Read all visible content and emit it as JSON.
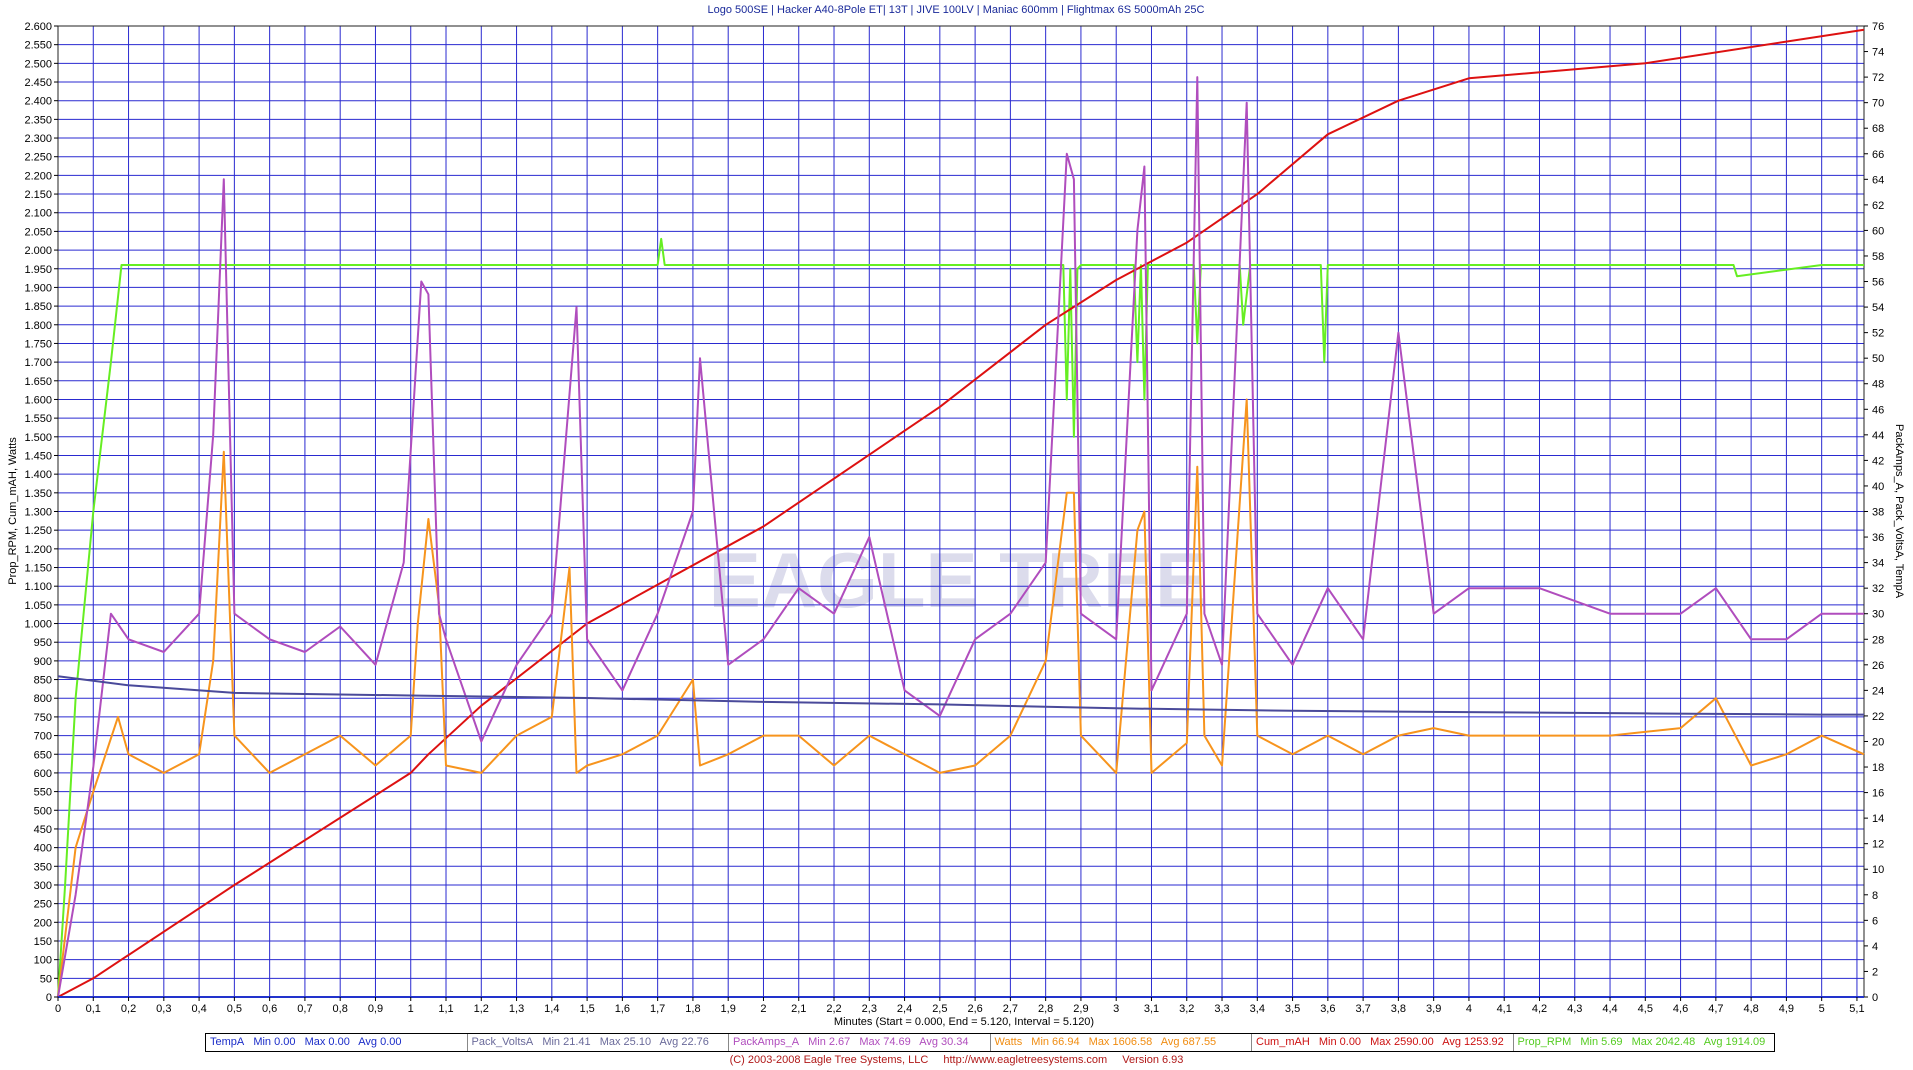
{
  "chart_data": {
    "type": "line",
    "title": "Logo 500SE | Hacker A40-8Pole ET| 13T | JIVE 100LV | Maniac 600mm | Flightmax 6S 5000mAh 25C",
    "xlabel": "Minutes (Start = 0.000, End = 5.120, Interval = 5.120)",
    "ylabel_left": "Prop_RPM, Cum_mAH, Watts",
    "ylabel_right": "PackAmps_A, Pack_VoltsA, TempA",
    "xlim": [
      0,
      5.12
    ],
    "ylim_left": [
      0,
      2600
    ],
    "ylim_right": [
      0,
      76
    ],
    "x_ticks": [
      "0",
      "0,1",
      "0,2",
      "0,3",
      "0,4",
      "0,5",
      "0,6",
      "0,7",
      "0,8",
      "0,9",
      "1",
      "1,1",
      "1,2",
      "1,3",
      "1,4",
      "1,5",
      "1,6",
      "1,7",
      "1,8",
      "1,9",
      "2",
      "2,1",
      "2,2",
      "2,3",
      "2,4",
      "2,5",
      "2,6",
      "2,7",
      "2,8",
      "2,9",
      "3",
      "3,1",
      "3,2",
      "3,3",
      "3,4",
      "3,5",
      "3,6",
      "3,7",
      "3,8",
      "3,9",
      "4",
      "4,1",
      "4,2",
      "4,3",
      "4,4",
      "4,5",
      "4,6",
      "4,7",
      "4,8",
      "4,9",
      "5",
      "5,1"
    ],
    "y_ticks_left": [
      "0",
      "50",
      "100",
      "150",
      "200",
      "250",
      "300",
      "350",
      "400",
      "450",
      "500",
      "550",
      "600",
      "650",
      "700",
      "750",
      "800",
      "850",
      "900",
      "950",
      "1.000",
      "1.050",
      "1.100",
      "1.150",
      "1.200",
      "1.250",
      "1.300",
      "1.350",
      "1.400",
      "1.450",
      "1.500",
      "1.550",
      "1.600",
      "1.650",
      "1.700",
      "1.750",
      "1.800",
      "1.850",
      "1.900",
      "1.950",
      "2.000",
      "2.050",
      "2.100",
      "2.150",
      "2.200",
      "2.250",
      "2.300",
      "2.350",
      "2.400",
      "2.450",
      "2.500",
      "2.550",
      "2.600"
    ],
    "y_ticks_right": [
      "0",
      "2",
      "4",
      "6",
      "8",
      "10",
      "12",
      "14",
      "16",
      "18",
      "20",
      "22",
      "24",
      "26",
      "28",
      "30",
      "32",
      "34",
      "36",
      "38",
      "40",
      "42",
      "44",
      "46",
      "48",
      "50",
      "52",
      "54",
      "56",
      "58",
      "60",
      "62",
      "64",
      "66",
      "68",
      "70",
      "72",
      "74",
      "76"
    ],
    "grid": true,
    "watermark": "EAGLE TREE",
    "series": [
      {
        "name": "Prop_RPM",
        "axis": "left",
        "color": "#66ee22",
        "x": [
          0,
          0.02,
          0.05,
          0.1,
          0.15,
          0.18,
          0.5,
          1.0,
          1.5,
          1.7,
          1.71,
          1.72,
          2.0,
          2.5,
          2.85,
          2.86,
          2.87,
          2.88,
          2.89,
          2.9,
          3.05,
          3.06,
          3.07,
          3.08,
          3.09,
          3.1,
          3.22,
          3.23,
          3.24,
          3.3,
          3.35,
          3.36,
          3.38,
          3.58,
          3.59,
          3.6,
          3.61,
          3.8,
          4.0,
          4.5,
          4.75,
          4.76,
          5.0,
          5.12
        ],
        "y": [
          0,
          300,
          800,
          1300,
          1700,
          1960,
          1960,
          1960,
          1960,
          1960,
          2030,
          1960,
          1960,
          1960,
          1960,
          1600,
          1950,
          1500,
          1950,
          1960,
          1960,
          1700,
          1960,
          1600,
          1960,
          1960,
          1960,
          1750,
          1960,
          1960,
          1960,
          1800,
          1960,
          1960,
          1700,
          1960,
          1960,
          1960,
          1960,
          1960,
          1960,
          1930,
          1960,
          1960
        ]
      },
      {
        "name": "Cum_mAH",
        "axis": "left",
        "color": "#dd1111",
        "x": [
          0,
          0.1,
          0.5,
          1.0,
          1.05,
          1.2,
          1.5,
          2.0,
          2.5,
          2.8,
          3.0,
          3.2,
          3.4,
          3.6,
          3.8,
          4.0,
          4.5,
          5.12
        ],
        "y": [
          0,
          50,
          300,
          600,
          650,
          780,
          1000,
          1260,
          1580,
          1800,
          1920,
          2020,
          2150,
          2310,
          2400,
          2460,
          2500,
          2590
        ]
      },
      {
        "name": "Watts",
        "axis": "left",
        "color": "#f7941d",
        "x": [
          0,
          0.05,
          0.1,
          0.17,
          0.2,
          0.3,
          0.4,
          0.44,
          0.47,
          0.5,
          0.6,
          0.7,
          0.8,
          0.9,
          1.0,
          1.02,
          1.05,
          1.08,
          1.1,
          1.2,
          1.3,
          1.4,
          1.45,
          1.47,
          1.5,
          1.6,
          1.7,
          1.8,
          1.82,
          1.9,
          2.0,
          2.1,
          2.2,
          2.3,
          2.4,
          2.5,
          2.6,
          2.7,
          2.8,
          2.86,
          2.88,
          2.9,
          3.0,
          3.06,
          3.08,
          3.1,
          3.2,
          3.23,
          3.25,
          3.3,
          3.37,
          3.4,
          3.5,
          3.6,
          3.7,
          3.8,
          3.9,
          4.0,
          4.2,
          4.4,
          4.6,
          4.7,
          4.8,
          4.9,
          5.0,
          5.12
        ],
        "y": [
          0,
          400,
          550,
          750,
          650,
          600,
          650,
          900,
          1460,
          700,
          600,
          650,
          700,
          620,
          700,
          1000,
          1280,
          1050,
          620,
          600,
          700,
          750,
          1150,
          600,
          620,
          650,
          700,
          850,
          620,
          650,
          700,
          700,
          620,
          700,
          650,
          600,
          620,
          700,
          900,
          1350,
          1350,
          700,
          600,
          1250,
          1300,
          600,
          680,
          1420,
          700,
          620,
          1600,
          700,
          650,
          700,
          650,
          700,
          720,
          700,
          700,
          700,
          720,
          800,
          620,
          650,
          700,
          650
        ]
      },
      {
        "name": "PackAmps_A",
        "axis": "right",
        "color": "#b04dbd",
        "x": [
          0,
          0.05,
          0.1,
          0.15,
          0.2,
          0.3,
          0.4,
          0.44,
          0.47,
          0.5,
          0.6,
          0.7,
          0.8,
          0.9,
          0.98,
          1.03,
          1.05,
          1.08,
          1.1,
          1.2,
          1.3,
          1.4,
          1.47,
          1.5,
          1.6,
          1.7,
          1.8,
          1.82,
          1.9,
          2.0,
          2.1,
          2.2,
          2.3,
          2.4,
          2.5,
          2.6,
          2.7,
          2.8,
          2.86,
          2.88,
          2.9,
          3.0,
          3.06,
          3.08,
          3.1,
          3.2,
          3.23,
          3.25,
          3.3,
          3.37,
          3.4,
          3.5,
          3.6,
          3.7,
          3.8,
          3.9,
          4.0,
          4.2,
          4.4,
          4.6,
          4.7,
          4.8,
          4.9,
          5.0,
          5.12
        ],
        "y": [
          0,
          8,
          18,
          30,
          28,
          27,
          30,
          44,
          64,
          30,
          28,
          27,
          29,
          26,
          34,
          56,
          55,
          30,
          28,
          20,
          26,
          30,
          54,
          28,
          24,
          30,
          38,
          50,
          26,
          28,
          32,
          30,
          36,
          24,
          22,
          28,
          30,
          34,
          66,
          64,
          30,
          28,
          60,
          65,
          24,
          30,
          72,
          30,
          26,
          70,
          30,
          26,
          32,
          28,
          52,
          30,
          32,
          32,
          30,
          30,
          32,
          28,
          28,
          30,
          30
        ]
      },
      {
        "name": "Pack_VoltsA",
        "axis": "right",
        "color": "#4a4a9a",
        "x": [
          0,
          0.2,
          0.5,
          1.0,
          1.5,
          2.0,
          2.5,
          3.0,
          3.5,
          4.0,
          4.5,
          5.0,
          5.12
        ],
        "y": [
          25.1,
          24.4,
          23.8,
          23.6,
          23.4,
          23.1,
          22.9,
          22.6,
          22.4,
          22.3,
          22.2,
          22.1,
          22.1
        ]
      },
      {
        "name": "TempA",
        "axis": "right",
        "color": "#2233cc",
        "x": [
          0,
          5.12
        ],
        "y": [
          0,
          0
        ]
      }
    ],
    "legend": [
      {
        "name": "TempA",
        "min": "Min 0.00",
        "max": "Max 0.00",
        "avg": "Avg 0.00",
        "color": "#1a2cc8"
      },
      {
        "name": "Pack_VoltsA",
        "min": "Min 21.41",
        "max": "Max 25.10",
        "avg": "Avg 22.76",
        "color": "#6a6a9a"
      },
      {
        "name": "PackAmps_A",
        "min": "Min 2.67",
        "max": "Max 74.69",
        "avg": "Avg 30.34",
        "color": "#b04dbd"
      },
      {
        "name": "Watts",
        "min": "Min 66.94",
        "max": "Max 1606.58",
        "avg": "Avg 687.55",
        "color": "#f08c10"
      },
      {
        "name": "Cum_mAH",
        "min": "Min 0.00",
        "max": "Max 2590.00",
        "avg": "Avg 1253.92",
        "color": "#cc1111"
      },
      {
        "name": "Prop_RPM",
        "min": "Min 5.69",
        "max": "Max 2042.48",
        "avg": "Avg 1914.09",
        "color": "#55cc22"
      }
    ]
  },
  "footer": {
    "copyright": "(C) 2003-2008 Eagle Tree Systems, LLC",
    "url": "http://www.eagletreesystems.com",
    "version": "Version 6.93"
  }
}
